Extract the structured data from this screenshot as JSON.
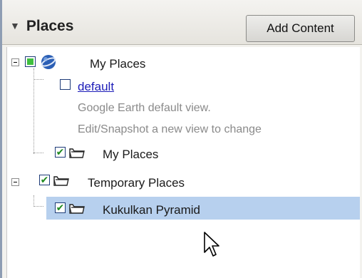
{
  "panel": {
    "title": "Places",
    "add_content_label": "Add Content"
  },
  "tree": {
    "my_places_root": {
      "label": "My Places"
    },
    "default_item": {
      "label": "default",
      "description_line1": "Google Earth default view.",
      "description_line2": "Edit/Snapshot a new view to change"
    },
    "my_places_folder": {
      "label": "My Places"
    },
    "temporary_places": {
      "label": "Temporary Places"
    },
    "kukulkan": {
      "label": "Kukulkan Pyramid"
    }
  },
  "icons": {
    "expand": "triangle-down-icon",
    "globe": "globe-icon",
    "folder": "folder-icon",
    "cursor": "mouse-pointer-icon"
  },
  "colors": {
    "selection": "#b7d0ee",
    "link": "#1c1cb8",
    "check": "#1f8a1f"
  }
}
